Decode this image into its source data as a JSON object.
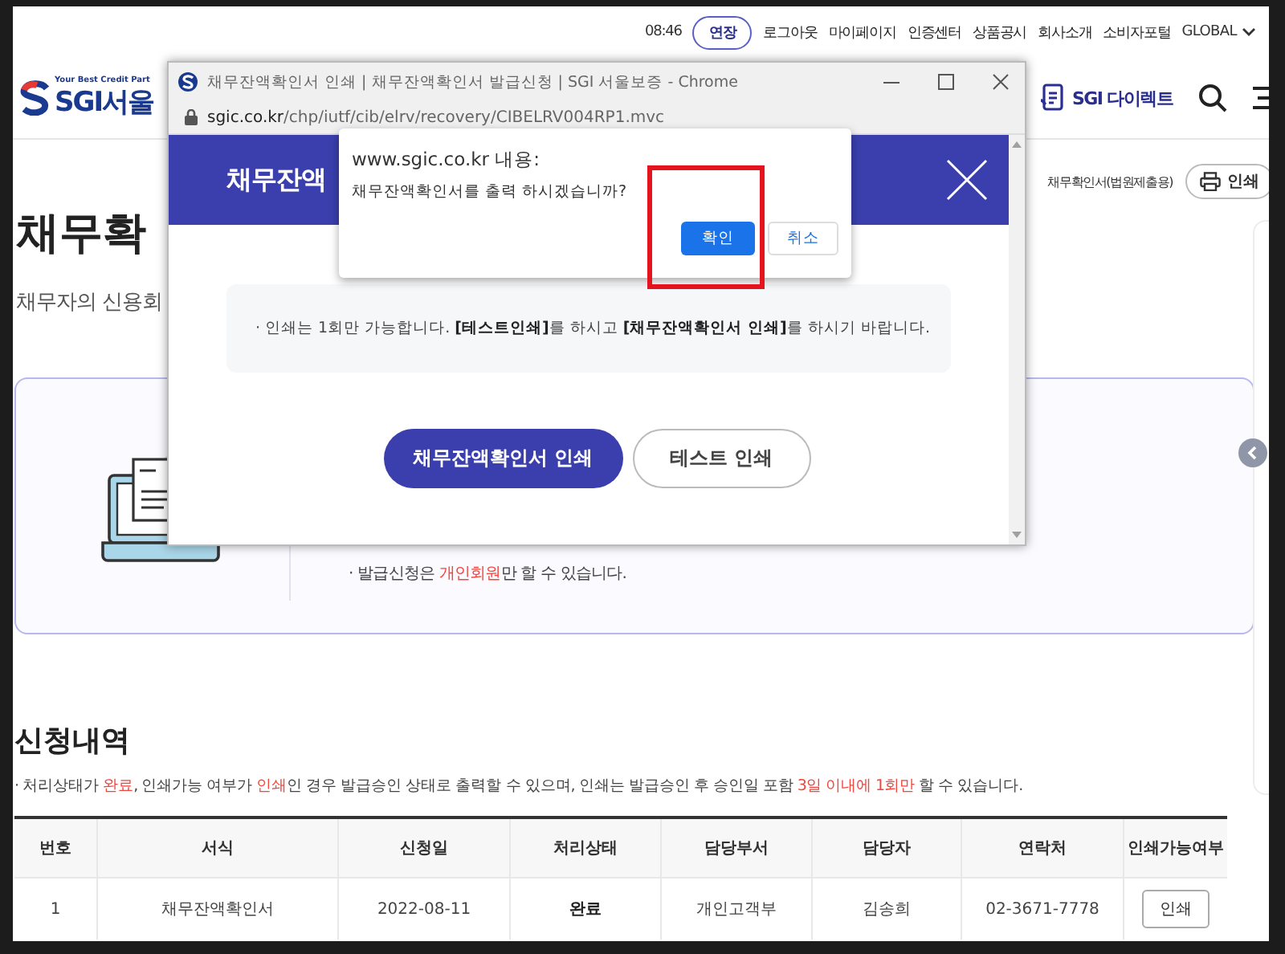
{
  "top_bar": {
    "time": "08:46",
    "extend_button": "연장",
    "links": [
      "로그아웃",
      "마이페이지",
      "인증센터",
      "상품공시",
      "회사소개",
      "소비자포털"
    ],
    "language": "GLOBAL"
  },
  "header": {
    "logo_tagline": "Your Best Credit Part",
    "logo_text": "SGI서울",
    "direct_link": "SGI 다이렉트"
  },
  "page": {
    "title": "채무확",
    "subtitle": "채무자의 신용회",
    "doc_label": "채무확인서(법원제출용)",
    "print_button": "인쇄"
  },
  "info_card": {
    "notes": [
      [
        {
          "text": "· 발급신청은 ",
          "highlight": false
        },
        {
          "text": "개인회원",
          "highlight": true
        },
        {
          "text": "만 할 수 있습니다.",
          "highlight": false
        }
      ]
    ]
  },
  "history": {
    "title": "신청내역",
    "note": [
      {
        "text": "· 처리상태가 ",
        "highlight": false
      },
      {
        "text": "완료",
        "highlight": true
      },
      {
        "text": ", 인쇄가능 여부가 ",
        "highlight": false
      },
      {
        "text": "인쇄",
        "highlight": true
      },
      {
        "text": "인 경우 발급승인 상태로 출력할 수 있으며, 인쇄는 발급승인 후 승인일 포함 ",
        "highlight": false
      },
      {
        "text": "3일 이내에 1회만",
        "highlight": true
      },
      {
        "text": " 할 수 있습니다.",
        "highlight": false
      }
    ],
    "table": {
      "columns": [
        "번호",
        "서식",
        "신청일",
        "처리상태",
        "담당부서",
        "담당자",
        "연락처",
        "인쇄가능여부"
      ],
      "rows": [
        {
          "number": "1",
          "form": "채무잔액확인서",
          "date": "2022-08-11",
          "status": "완료",
          "department": "개인고객부",
          "manager": "김송희",
          "phone": "02-3671-7778",
          "print_button": "인쇄"
        }
      ]
    }
  },
  "popup_window": {
    "title": "채무잔액확인서 인쇄 | 채무잔액확인서 발급신청 | SGI 서울보증 - Chrome",
    "url_host": "sgic.co.kr",
    "url_path": "/chp/iutf/cib/elrv/recovery/CIBELRV004RP1.mvc",
    "header_title": "채무잔액",
    "notice": "· 인쇄는 1회만 가능합니다. **[테스트인쇄]**를 하시고 **[채무잔액확인서 인쇄]**를 하시기 바랍니다.",
    "buttons": [
      {
        "label": "채무잔액확인서 인쇄",
        "kind": "primary"
      },
      {
        "label": "테스트 인쇄",
        "kind": "secondary"
      }
    ]
  },
  "alert": {
    "origin": "www.sgic.co.kr 내용:",
    "message": "채무잔액확인서를 출력 하시겠습니까?",
    "buttons": [
      {
        "label": "확인",
        "kind": "primary"
      },
      {
        "label": "취소",
        "kind": "secondary"
      }
    ]
  }
}
